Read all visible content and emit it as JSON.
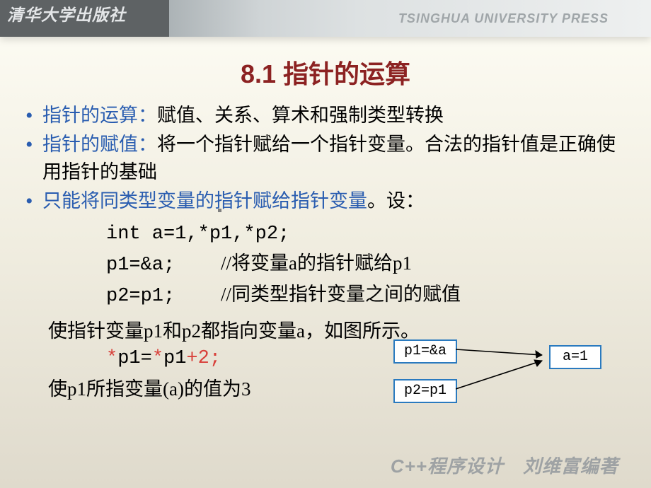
{
  "header": {
    "left": "清华大学出版社",
    "right": "TSINGHUA UNIVERSITY PRESS"
  },
  "title": "8.1 指针的运算",
  "bullets": [
    {
      "lead": "指针的运算：",
      "rest": "赋值、关系、算术和强制类型转换"
    },
    {
      "lead": "指针的赋值：",
      "rest": "将一个指针赋给一个指针变量。合法的指针值是正确使用指针的基础"
    },
    {
      "lead": "只能将同类型变量的指针赋给指针变量",
      "rest": "。设："
    }
  ],
  "code": {
    "l1": "int a=1,*p1,*p2;",
    "l2_a": "p1=&a;",
    "l2_b": "//将变量a的指针赋给p1",
    "l3_a": "p2=p1;",
    "l3_b": "//同类型指针变量之间的赋值"
  },
  "explain1": "使指针变量p1和p2都指向变量a，如图所示。",
  "expr": {
    "pre": "*",
    "mid1": "p1=",
    "star2": "*",
    "mid2": "p1",
    "tail": "+2;"
  },
  "explain2": "使p1所指变量(a)的值为3",
  "diagram": {
    "p1": "p1=&a",
    "p2": "p2=p1",
    "a": "a=1"
  },
  "footer": "C++程序设计　刘维富编著"
}
